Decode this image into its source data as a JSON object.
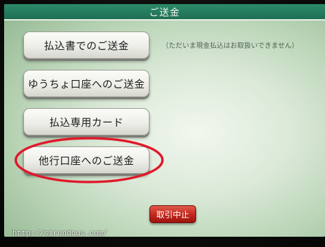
{
  "header": {
    "title": "ご送金"
  },
  "menu": {
    "items": [
      {
        "label": "払込書でのご送金"
      },
      {
        "label": "ゆうちょ口座へのご送金"
      },
      {
        "label": "払込専用カード"
      },
      {
        "label": "他行口座へのご送金"
      }
    ],
    "note": "（ただいま現金払込はお取扱いできません）"
  },
  "footer": {
    "cancel_label": "取引中止"
  },
  "watermark": {
    "url": "http://sirundous.com/"
  },
  "colors": {
    "title_bar": "#1f6f54",
    "screen_bg": "#dbe9d8",
    "cancel_button": "#c2261c",
    "highlight_ring": "#e0182a"
  }
}
